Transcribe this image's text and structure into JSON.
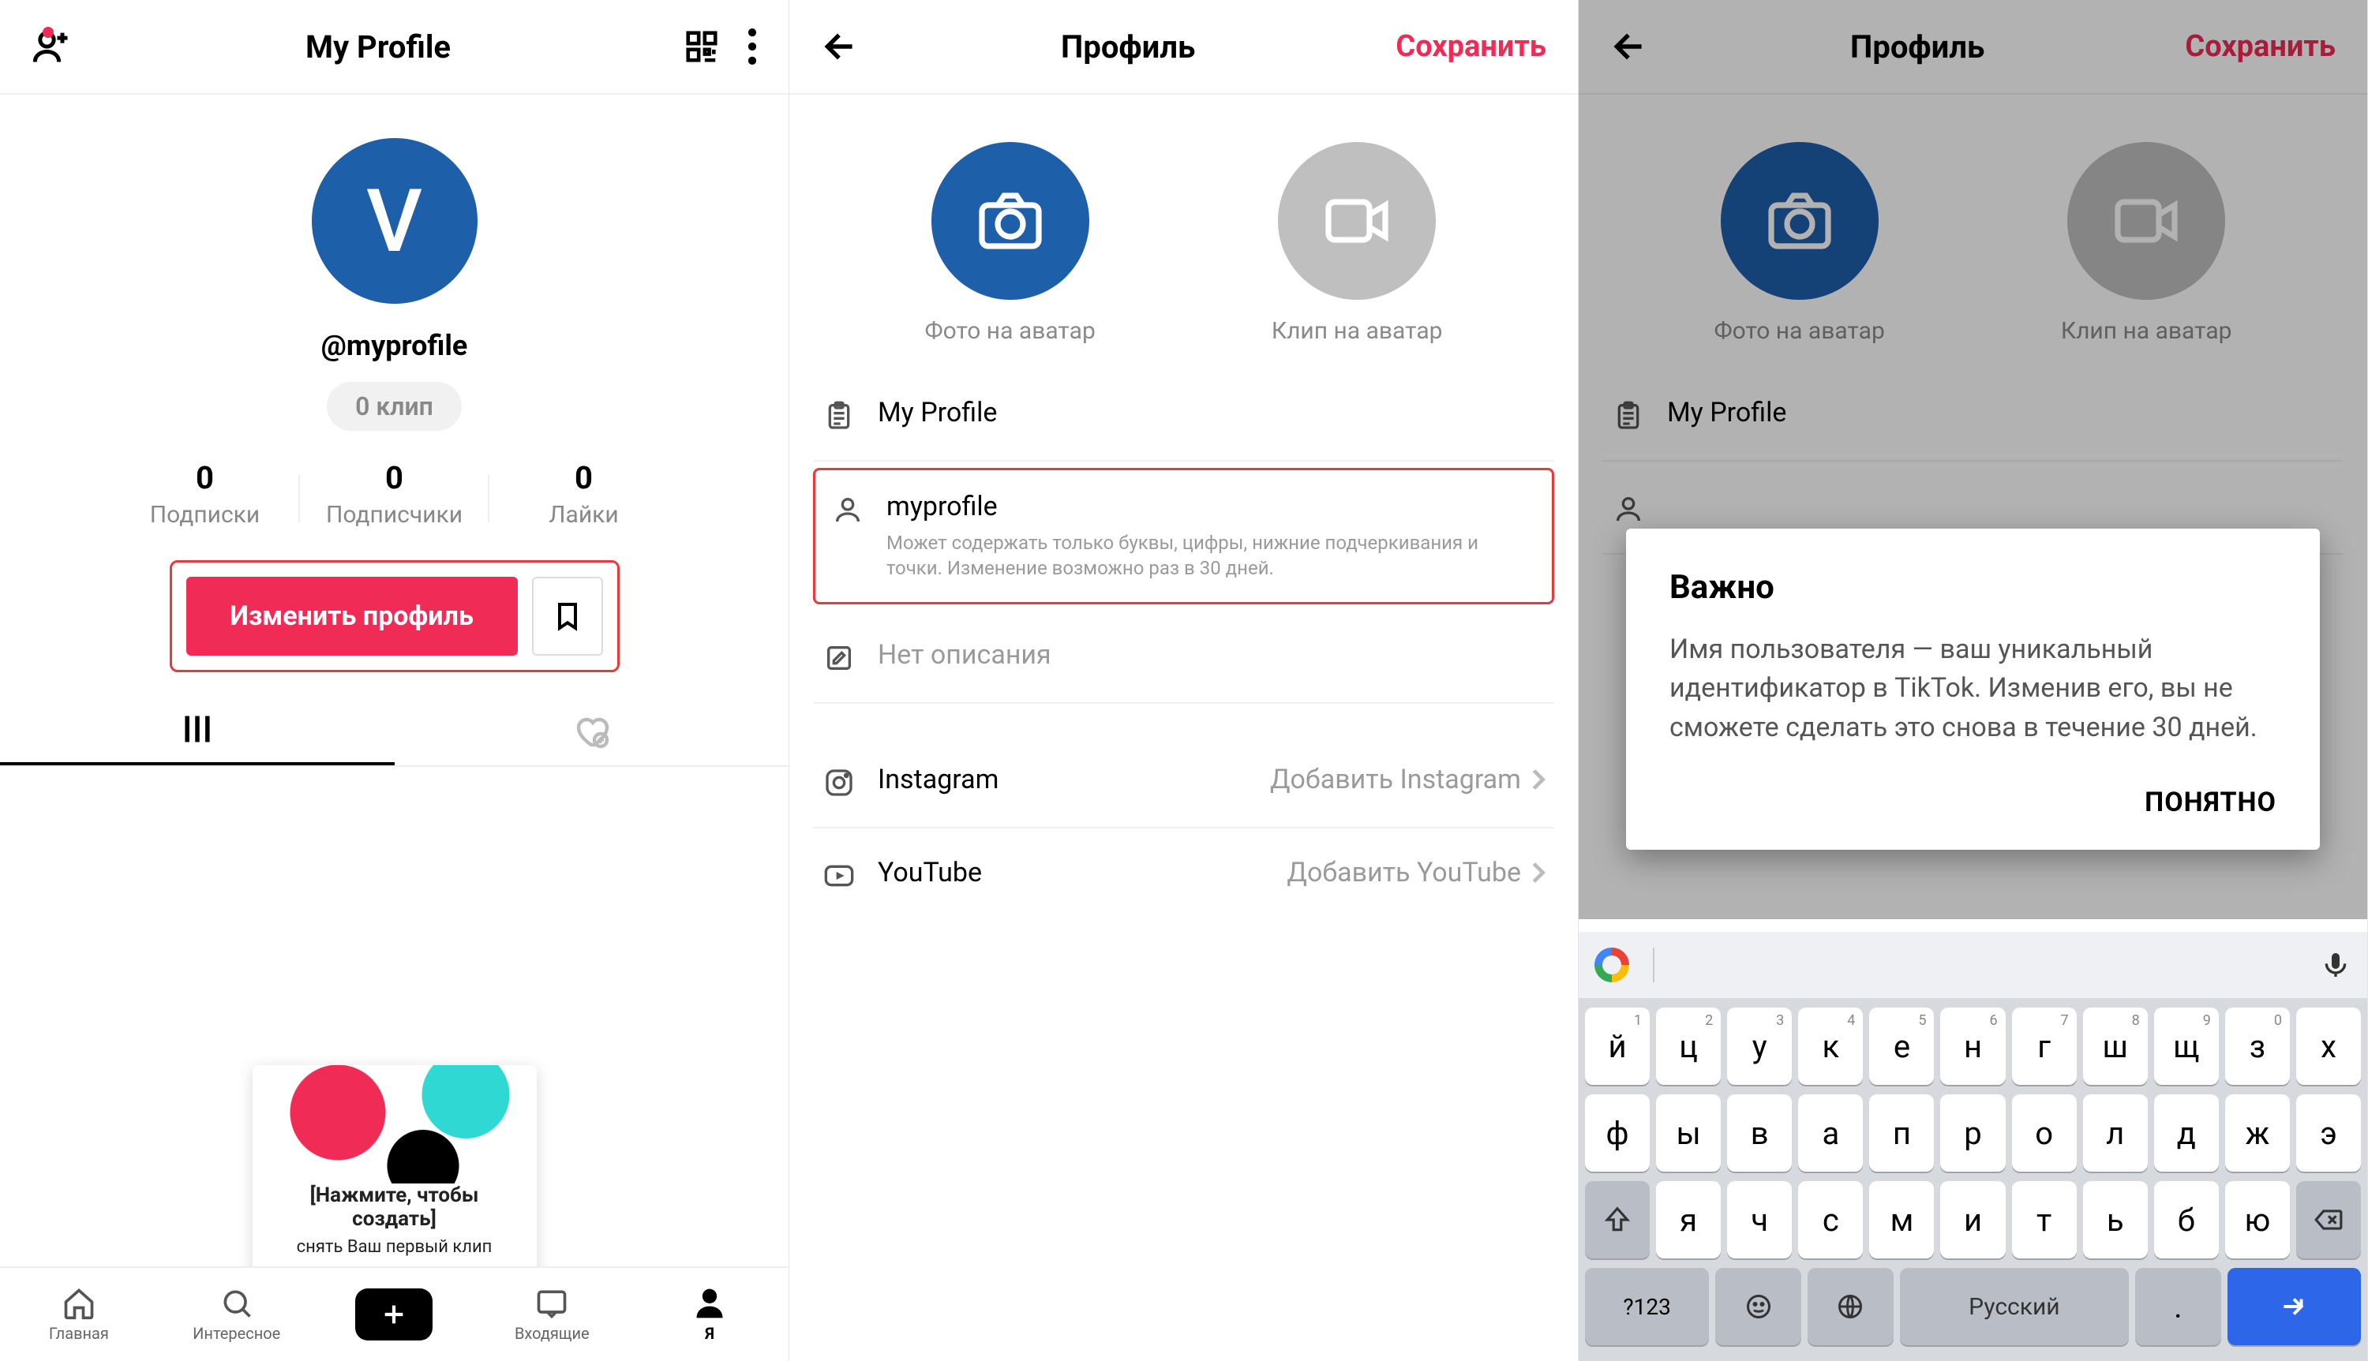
{
  "screen1": {
    "header_title": "My Profile",
    "avatar_letter": "V",
    "handle": "@myprofile",
    "clip_badge": "0 клип",
    "stats": [
      {
        "num": "0",
        "lbl": "Подписки"
      },
      {
        "num": "0",
        "lbl": "Подписчики"
      },
      {
        "num": "0",
        "lbl": "Лайки"
      }
    ],
    "edit_btn": "Изменить профиль",
    "create_card": {
      "l1": "[Нажмите, чтобы создать]",
      "l2": "снять Ваш первый клип"
    },
    "nav": {
      "home": "Главная",
      "discover": "Интересное",
      "inbox": "Входящие",
      "me": "Я"
    }
  },
  "screen2": {
    "header_title": "Профиль",
    "save": "Сохранить",
    "photo_lbl": "Фото на аватар",
    "video_lbl": "Клип на аватар",
    "rows": {
      "name": "My Profile",
      "username": "myprofile",
      "username_hint": "Может содержать только буквы, цифры, нижние подчеркивания и точки. Изменение возможно раз в 30 дней.",
      "bio_placeholder": "Нет описания",
      "instagram_label": "Instagram",
      "instagram_action": "Добавить Instagram",
      "youtube_label": "YouTube",
      "youtube_action": "Добавить YouTube"
    }
  },
  "screen3": {
    "header_title": "Профиль",
    "save": "Сохранить",
    "photo_lbl": "Фото на аватар",
    "video_lbl": "Клип на аватар",
    "name": "My Profile",
    "modal": {
      "title": "Важно",
      "text": "Имя пользователя — ваш уникальный идентификатор в TikTok. Изменив его, вы не сможете сделать это снова в течение 30 дней.",
      "button": "ПОНЯТНО"
    },
    "keyboard": {
      "row1": [
        {
          "k": "й",
          "s": "1"
        },
        {
          "k": "ц",
          "s": "2"
        },
        {
          "k": "у",
          "s": "3"
        },
        {
          "k": "к",
          "s": "4"
        },
        {
          "k": "е",
          "s": "5"
        },
        {
          "k": "н",
          "s": "6"
        },
        {
          "k": "г",
          "s": "7"
        },
        {
          "k": "ш",
          "s": "8"
        },
        {
          "k": "щ",
          "s": "9"
        },
        {
          "k": "з",
          "s": "0"
        },
        {
          "k": "х",
          "s": ""
        }
      ],
      "row2": [
        "ф",
        "ы",
        "в",
        "а",
        "п",
        "р",
        "о",
        "л",
        "д",
        "ж",
        "э"
      ],
      "row3": [
        "я",
        "ч",
        "с",
        "м",
        "и",
        "т",
        "ь",
        "б",
        "ю"
      ],
      "mode_key": "?123",
      "lang": "Русский"
    }
  }
}
